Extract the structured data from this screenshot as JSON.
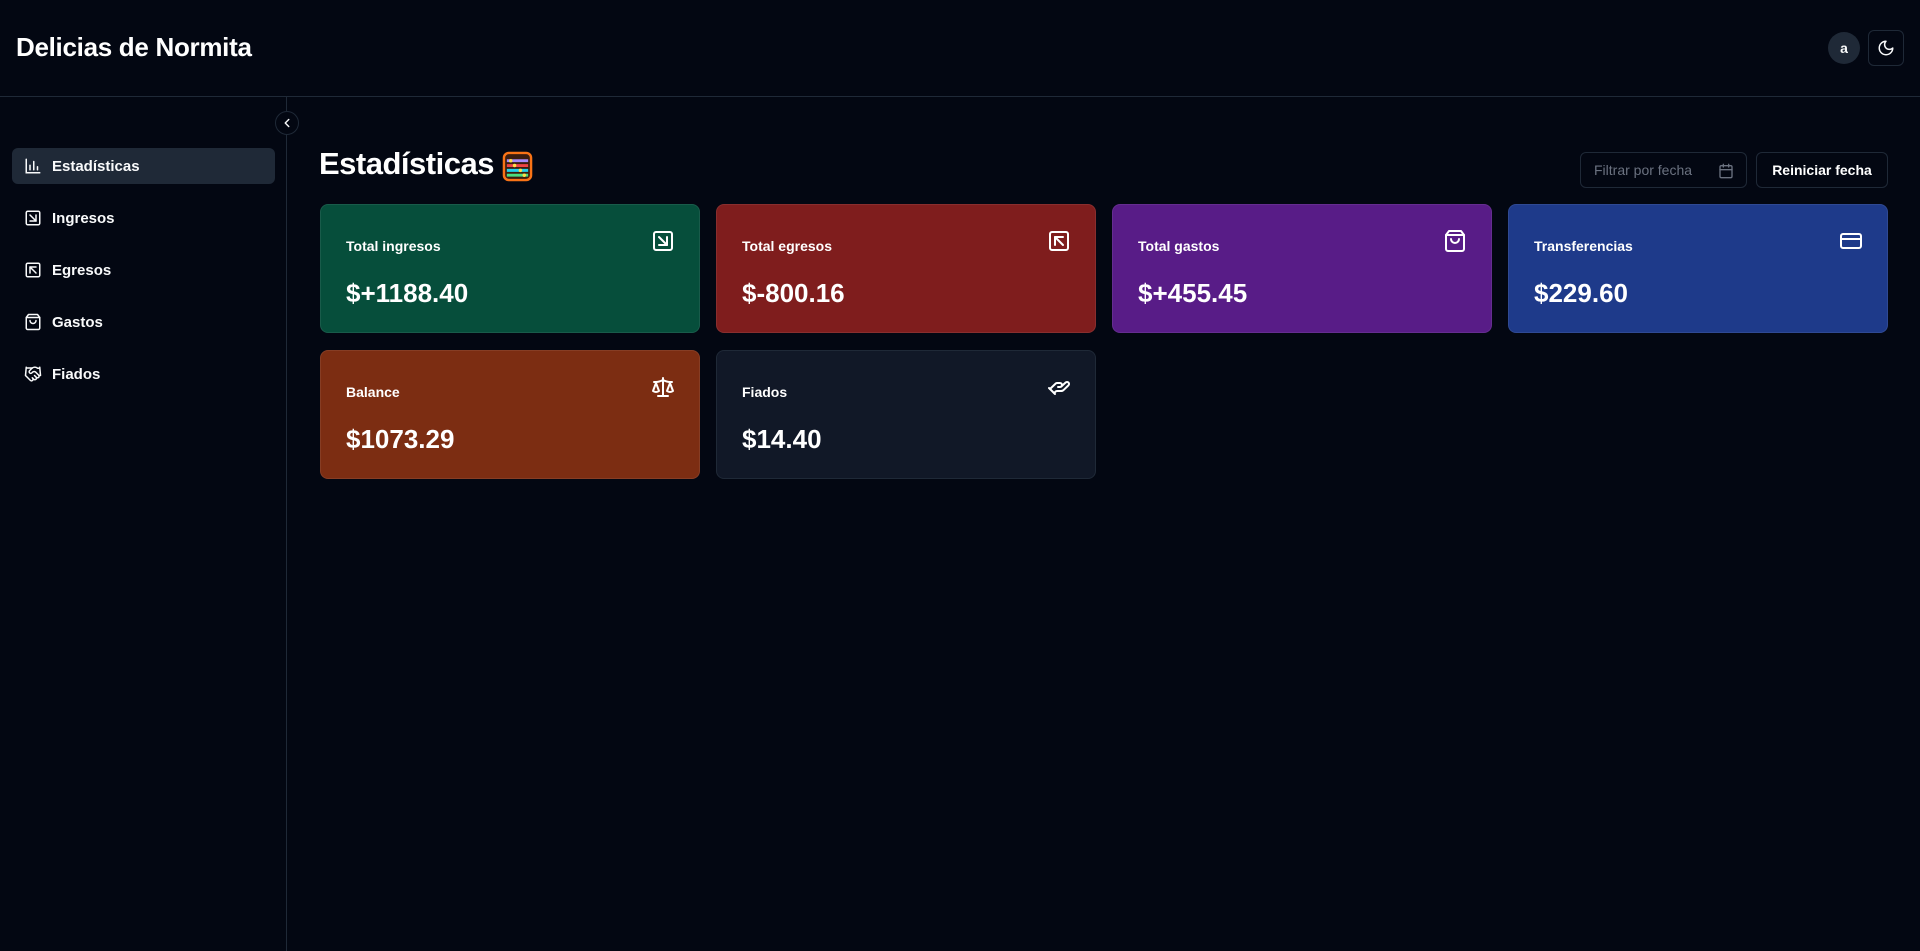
{
  "header": {
    "brand": "Delicias de Normita",
    "avatar_letter": "a",
    "theme_icon": "moon-icon"
  },
  "sidebar": {
    "items": [
      {
        "label": "Estadísticas",
        "icon": "bar-chart-icon",
        "active": true
      },
      {
        "label": "Ingresos",
        "icon": "arrow-down-right-square-icon",
        "active": false
      },
      {
        "label": "Egresos",
        "icon": "arrow-up-left-square-icon",
        "active": false
      },
      {
        "label": "Gastos",
        "icon": "shopping-bag-icon",
        "active": false
      },
      {
        "label": "Fiados",
        "icon": "handshake-icon",
        "active": false
      }
    ]
  },
  "main": {
    "title": "Estadísticas",
    "title_emoji": "abacus-icon",
    "date_filter": {
      "placeholder": "Filtrar por fecha",
      "value": ""
    },
    "reset_label": "Reiniciar fecha",
    "cards": [
      {
        "title": "Total ingresos",
        "value": "$+1188.40",
        "color": "#064e3b",
        "icon": "arrow-down-right-square-icon"
      },
      {
        "title": "Total egresos",
        "value": "$-800.16",
        "color": "#7f1d1d",
        "icon": "arrow-up-left-square-icon"
      },
      {
        "title": "Total gastos",
        "value": "$+455.45",
        "color": "#581c87",
        "icon": "shopping-bag-icon"
      },
      {
        "title": "Transferencias",
        "value": "$229.60",
        "color": "#1e3a8a",
        "icon": "credit-card-icon"
      },
      {
        "title": "Balance",
        "value": "$1073.29",
        "color": "#7c2d12",
        "icon": "scale-icon"
      },
      {
        "title": "Fiados",
        "value": "$14.40",
        "color": "#111827",
        "icon": "handshake-icon"
      }
    ]
  }
}
